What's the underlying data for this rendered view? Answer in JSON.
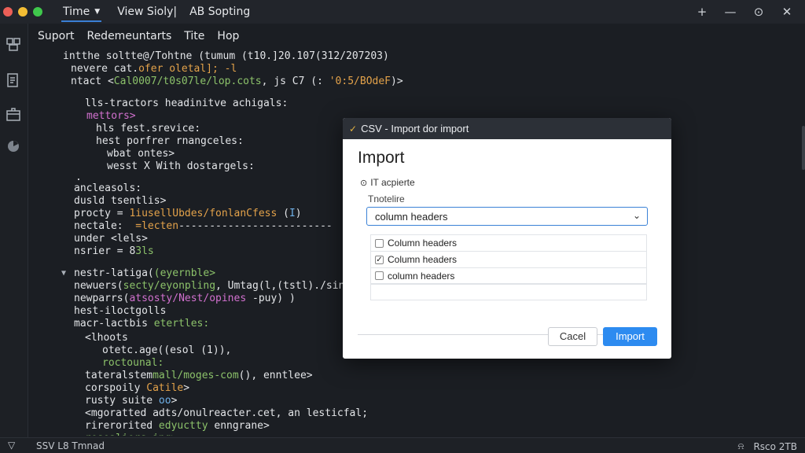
{
  "window": {
    "tab_label": "Time",
    "menu": [
      "View Sioly|",
      "AB Sopting"
    ],
    "actions": {
      "add": "+",
      "minimize": "—",
      "history": "⊙",
      "close": "✕"
    }
  },
  "menubar": [
    "Suport",
    "Redemeuntarts",
    "Tite",
    "Hop"
  ],
  "editor": {
    "lines": [
      {
        "segs": [
          {
            "t": "intthe soltte"
          },
          {
            "t": "@/Tohtne (tumum (t10.]20.107(312/207203)"
          }
        ]
      },
      {
        "segs": [
          {
            "t": "nevere cat."
          },
          {
            "t": "ofer oletal]; -l",
            "c": "orange"
          }
        ]
      },
      {
        "segs": [
          {
            "t": "ntact <"
          },
          {
            "t": "Cal0007/t0s07le/lop.cots",
            "c": "green"
          },
          {
            "t": ", js C7 (: "
          },
          {
            "t": "'0:5/BOdeF",
            "c": "orange"
          },
          {
            "t": ")>"
          }
        ]
      },
      {
        "segs": [
          {
            "t": "lls-tractors headinitve achigals:"
          }
        ]
      },
      {
        "segs": [
          {
            "t": "mettors>",
            "c": "pink"
          }
        ]
      },
      {
        "segs": [
          {
            "t": "hls fest.srevice:"
          }
        ]
      },
      {
        "segs": [
          {
            "t": "hest porfrer rnangceles:"
          }
        ]
      },
      {
        "segs": [
          {
            "t": "wbat ontes>"
          }
        ]
      },
      {
        "segs": [
          {
            "t": "wesst X With dostargels:"
          }
        ]
      },
      {
        "segs": [
          {
            "t": "."
          }
        ]
      },
      {
        "segs": [
          {
            "t": "ancleasols:"
          }
        ]
      },
      {
        "segs": [
          {
            "t": "dusld tsentlis>"
          }
        ]
      },
      {
        "segs": [
          {
            "t": "procty = "
          },
          {
            "t": "1iusellUbdes/fonlanCfess",
            "c": "orange"
          },
          {
            "t": " ("
          },
          {
            "t": "I",
            "c": "blue"
          },
          {
            "t": ")"
          }
        ]
      },
      {
        "segs": [
          {
            "t": "nectale:  "
          },
          {
            "t": "=lecten",
            "c": "orange"
          },
          {
            "t": "-------------------------"
          }
        ]
      },
      {
        "segs": [
          {
            "t": "under <lels>"
          }
        ]
      },
      {
        "segs": [
          {
            "t": "nsrier = "
          },
          {
            "t": "8"
          },
          {
            "t": "3ls",
            "c": "green"
          }
        ]
      },
      {
        "segs": [
          {
            "t": "nestr-latiga("
          },
          {
            "t": "(eyernble>",
            "c": "green"
          }
        ]
      },
      {
        "segs": [
          {
            "t": "newuers("
          },
          {
            "t": "secty/eyonpling",
            "c": "green"
          },
          {
            "t": ", Umtag(l,(tstl)./sing"
          }
        ]
      },
      {
        "segs": [
          {
            "t": "newparrs("
          },
          {
            "t": "atsosty/Nest/opines",
            "c": "pink"
          },
          {
            "t": " -puy) )"
          }
        ]
      },
      {
        "segs": [
          {
            "t": "hest-iloctgolls"
          }
        ]
      },
      {
        "segs": [
          {
            "t": "macr-lactbis "
          },
          {
            "t": "etertles:",
            "c": "green"
          }
        ]
      },
      {
        "segs": [
          {
            "t": "<lhoots"
          }
        ]
      },
      {
        "segs": [
          {
            "t": "otetc.age((esol (1)),"
          }
        ]
      },
      {
        "segs": [
          {
            "t": "roctounal:",
            "c": "green"
          }
        ]
      },
      {
        "segs": [
          {
            "t": "tateralstem"
          },
          {
            "t": "mall/moges-com",
            "c": "green"
          },
          {
            "t": "(), enntlee>"
          }
        ]
      },
      {
        "segs": [
          {
            "t": "corspoily "
          },
          {
            "t": "Catile",
            "c": "orange"
          },
          {
            "t": ">"
          }
        ]
      },
      {
        "segs": [
          {
            "t": "rusty suite "
          },
          {
            "t": "oo",
            "c": "blue"
          },
          {
            "t": ">"
          }
        ]
      },
      {
        "segs": [
          {
            "t": "<mgoratted adts/onulreacter.cet, an lesticfal;"
          }
        ]
      },
      {
        "segs": [
          {
            "t": "rirerorited "
          },
          {
            "t": "edyuctty",
            "c": "green"
          },
          {
            "t": " enngrane>"
          }
        ]
      },
      {
        "segs": [
          {
            "t": "resoaliers ing>",
            "c": "green"
          }
        ]
      }
    ]
  },
  "dialog": {
    "title": "CSV - Import dor import",
    "heading": "Import",
    "subtitle": "IT acpierte",
    "field_label": "Tnotelire",
    "select_value": "column headers",
    "options": [
      {
        "label": "Column headers",
        "checked": false
      },
      {
        "label": "Column headers",
        "checked": true
      },
      {
        "label": "column headers",
        "checked": false
      }
    ],
    "cancel_label": "Cacel",
    "import_label": "Import"
  },
  "status": {
    "left": "SSV L8 Tmnad",
    "right": "Rsco 2TB"
  },
  "colors": {
    "accent": "#2d8bf0",
    "background": "#1b1e23"
  }
}
